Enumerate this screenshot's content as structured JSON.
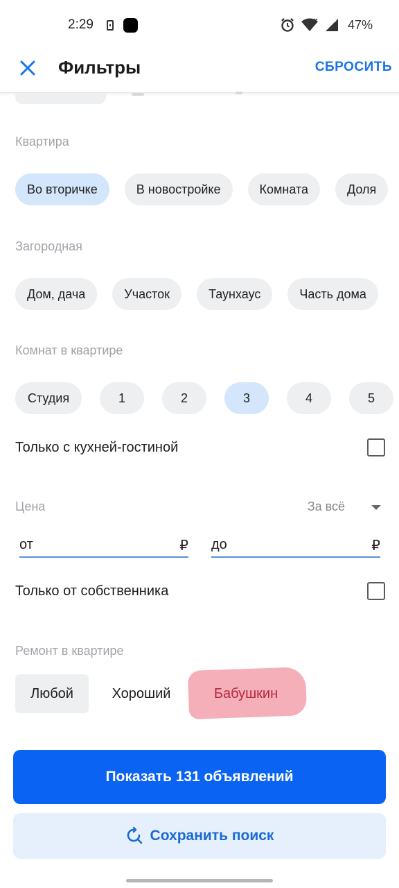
{
  "status_bar": {
    "time": "2:29",
    "battery": "47%"
  },
  "header": {
    "title": "Фильтры",
    "reset_label": "СБРОСИТЬ"
  },
  "sections": {
    "apartment": {
      "label": "Квартира",
      "options": [
        "Во вторичке",
        "В новостройке",
        "Комната",
        "Доля"
      ],
      "selected": "Во вторичке"
    },
    "country": {
      "label": "Загородная",
      "options": [
        "Дом, дача",
        "Участок",
        "Таунхаус",
        "Часть дома"
      ]
    },
    "rooms": {
      "label": "Комнат в квартире",
      "options": [
        "Студия",
        "1",
        "2",
        "3",
        "4",
        "5"
      ],
      "selected": "3"
    }
  },
  "kitchen_living": {
    "label": "Только с кухней-гостиной",
    "checked": false
  },
  "price": {
    "label": "Цена",
    "unit": "За всё",
    "from_placeholder": "от",
    "to_placeholder": "до",
    "currency": "₽"
  },
  "owner_only": {
    "label": "Только от собственника",
    "checked": false
  },
  "repair": {
    "label": "Ремонт в квартире",
    "options": [
      "Любой",
      "Хороший",
      "Бабушкин"
    ],
    "selected": "Любой"
  },
  "actions": {
    "show_label": "Показать 131 объявлений",
    "save_label": "Сохранить поиск"
  },
  "colors": {
    "accent": "#0a63f2",
    "selected_chip": "#d3e6fb",
    "chip": "#eeeff1"
  }
}
